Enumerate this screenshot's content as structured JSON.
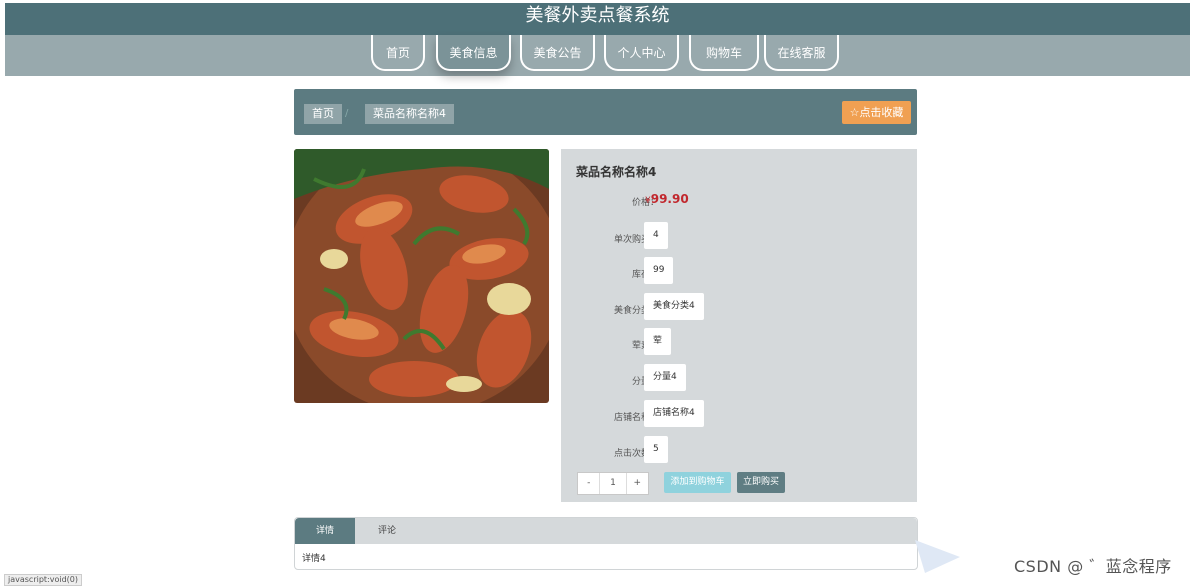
{
  "app": {
    "title": "美餐外卖点餐系统"
  },
  "nav": {
    "items": [
      {
        "label": "首页",
        "active": false
      },
      {
        "label": "美食信息",
        "active": true
      },
      {
        "label": "美食公告",
        "active": false
      },
      {
        "label": "个人中心",
        "active": false
      },
      {
        "label": "购物车",
        "active": false
      },
      {
        "label": "在线客服",
        "active": false
      }
    ]
  },
  "breadcrumb": {
    "home": "首页",
    "current": "菜品名称名称4",
    "separator": "/"
  },
  "favorite_button": {
    "label": "点击收藏",
    "icon": "star-outline-icon"
  },
  "product": {
    "name": "菜品名称名称4",
    "price_label": "价格：",
    "price_currency": "¥",
    "price_value": "99.90",
    "fields": [
      {
        "label": "单次购买：",
        "value": "4"
      },
      {
        "label": "库存：",
        "value": "99"
      },
      {
        "label": "美食分类：",
        "value": "美食分类4"
      },
      {
        "label": "荤素：",
        "value": "荤"
      },
      {
        "label": "分量：",
        "value": "分量4"
      },
      {
        "label": "店铺名称：",
        "value": "店铺名称4"
      },
      {
        "label": "点击次数：",
        "value": "5"
      }
    ]
  },
  "purchase": {
    "decrement": "-",
    "quantity": "1",
    "increment": "+",
    "add_to_cart": "添加到购物车",
    "buy_now": "立即购买"
  },
  "tabs": {
    "items": [
      {
        "label": "详情",
        "active": true
      },
      {
        "label": "评论",
        "active": false
      }
    ],
    "content": "详情4"
  },
  "watermark": "CSDN @ ゛蓝念程序",
  "status_bar": {
    "text": "javascript:void(0)"
  },
  "colors": {
    "header": "#4d7078",
    "nav": "#98a9ad",
    "accent_orange": "#f0a052",
    "price_red": "#c1272d",
    "cart_cyan": "#8fd2dd"
  }
}
